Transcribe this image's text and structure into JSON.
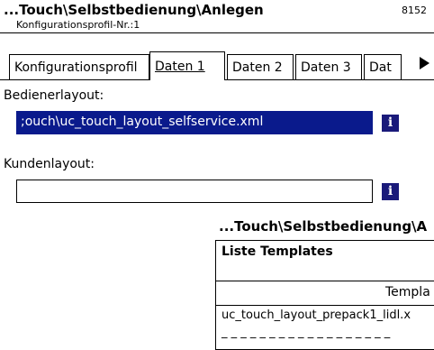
{
  "header": {
    "title": "...Touch\\Selbstbedienung\\Anlegen",
    "subtitle": "Konfigurationsprofil-Nr.:1",
    "code": "8152"
  },
  "tabs": [
    {
      "label": "Konfigurationsprofil",
      "active": false
    },
    {
      "label": "Daten 1",
      "active": true
    },
    {
      "label": "Daten 2",
      "active": false
    },
    {
      "label": "Daten 3",
      "active": false
    },
    {
      "label": "Dat",
      "active": false
    }
  ],
  "form": {
    "operator_layout": {
      "label": "Bedienerlayout:",
      "value": ";ouch\\uc_touch_layout_selfservice.xml",
      "info": "i"
    },
    "customer_layout": {
      "label": "Kundenlayout:",
      "value": "",
      "info": "i"
    }
  },
  "popup": {
    "title": "...Touch\\Selbstbedienung\\A",
    "heading": "Liste Templates",
    "column_header": "Templa",
    "rows": [
      "uc_touch_layout_prepack1_lidl.x",
      "_ _ _ _ _ _ _ _ _ _ _ _ _ _ _ _ _ _"
    ]
  },
  "colors": {
    "selection": "#0a1a8c",
    "info_button": "#1a1a7a"
  }
}
